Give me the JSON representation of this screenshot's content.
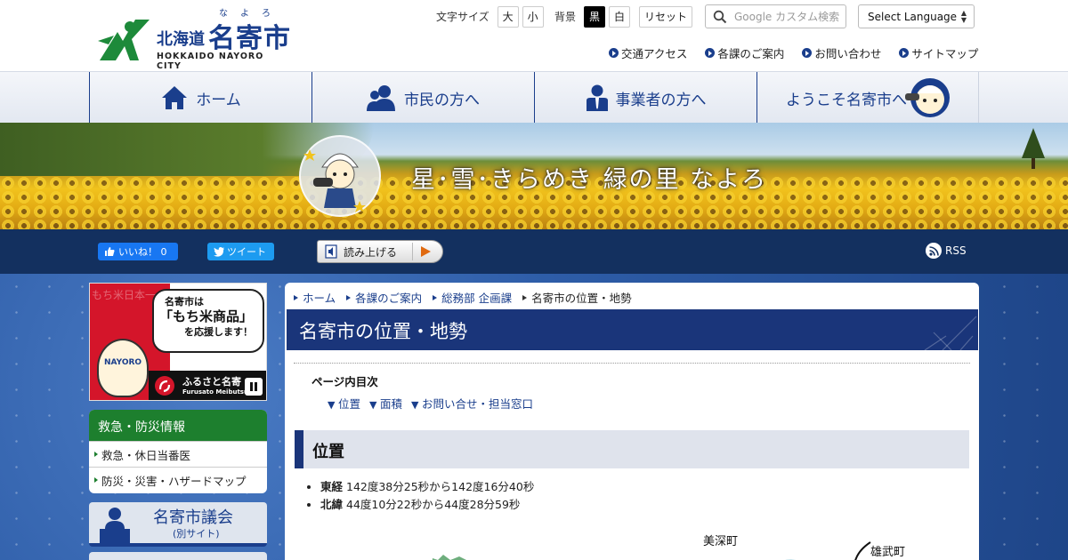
{
  "header": {
    "logo": {
      "prefecture": "北海道",
      "city": "名寄市",
      "ruby": "なよろ",
      "english": "HOKKAIDO NAYORO CITY"
    },
    "font_size": {
      "label": "文字サイズ",
      "large": "大",
      "small": "小"
    },
    "background": {
      "label": "背景",
      "black": "黒",
      "white": "白",
      "reset": "リセット"
    },
    "search": {
      "placeholder": "Google カスタム検索"
    },
    "language": {
      "label": "Select Language"
    },
    "sublinks": [
      "交通アクセス",
      "各課のご案内",
      "お問い合わせ",
      "サイトマップ"
    ]
  },
  "nav": {
    "items": [
      {
        "label": "ホーム",
        "icon": "home-icon"
      },
      {
        "label": "市民の方へ",
        "icon": "citizen-icon"
      },
      {
        "label": "事業者の方へ",
        "icon": "business-icon"
      },
      {
        "label": "ようこそ名寄市へ",
        "icon": "mascot-icon"
      }
    ]
  },
  "banner": {
    "title": "星･雪･きらめき 緑の里 なよろ"
  },
  "sharebar": {
    "like": "いいね！ 0",
    "tweet": "ツイート",
    "read_aloud": "読み上げる",
    "rss": "RSS"
  },
  "sidebar": {
    "promo": {
      "bg_text": "もち米日本一",
      "line1": "名寄市は",
      "line2": "「もち米商品」",
      "line3": "を応援します！",
      "brand": "ふるさと名寄",
      "brand_en": "Furusato Meibutsu",
      "mascot_label": "NAYORO"
    },
    "disaster": {
      "title": "救急・防災情報",
      "items": [
        "救急・休日当番医",
        "防災・災害・ハザードマップ"
      ]
    },
    "council": {
      "title": "名寄市議会",
      "sub": "(別サイト)"
    }
  },
  "main": {
    "breadcrumb": [
      "ホーム",
      "各課のご案内",
      "総務部 企画課",
      "名寄市の位置・地勢"
    ],
    "page_title": "名寄市の位置・地勢",
    "toc": {
      "title": "ページ内目次",
      "links": [
        "位置",
        "面積",
        "お問い合せ・担当窓口"
      ]
    },
    "section_title": "位置",
    "points": [
      {
        "label": "東経",
        "value": "142度38分25秒から142度16分40秒"
      },
      {
        "label": "北緯",
        "value": "44度10分22秒から44度28分59秒"
      }
    ],
    "map_labels": [
      "美深町",
      "雄武町"
    ]
  },
  "colors": {
    "brand_blue": "#1a3e8c",
    "title_navy": "#1a357a",
    "disaster_green": "#1d7f2e",
    "share_bar": "#13305f"
  }
}
